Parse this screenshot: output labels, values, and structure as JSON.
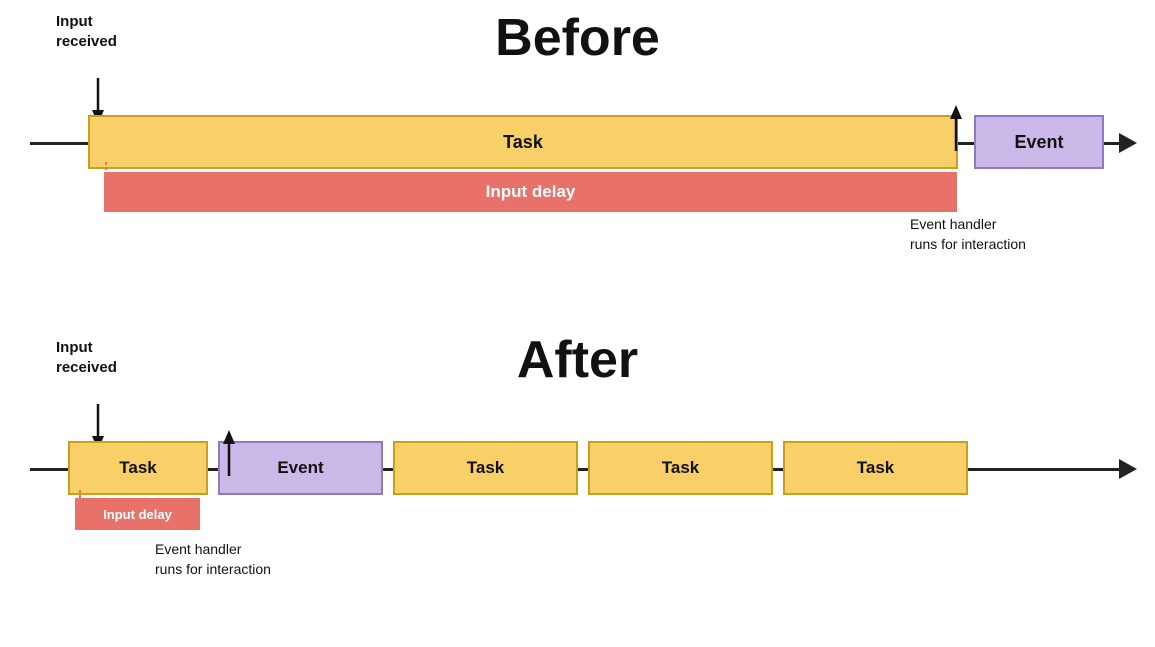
{
  "before": {
    "title": "Before",
    "input_received_label": "Input\nreceived",
    "task_label": "Task",
    "event_label": "Event",
    "input_delay_label": "Input delay",
    "event_handler_label": "Event handler\nruns for interaction"
  },
  "after": {
    "title": "After",
    "input_received_label": "Input\nreceived",
    "task_label_1": "Task",
    "event_label": "Event",
    "task_label_2": "Task",
    "task_label_3": "Task",
    "task_label_4": "Task",
    "input_delay_label": "Input delay",
    "event_handler_label": "Event handler\nruns for interaction"
  },
  "colors": {
    "task_bg": "#F9CF67",
    "task_border": "#c8a020",
    "event_bg": "#C9B8E8",
    "event_border": "#9278c0",
    "delay_bg": "#E8726A",
    "timeline": "#222",
    "text": "#111"
  }
}
